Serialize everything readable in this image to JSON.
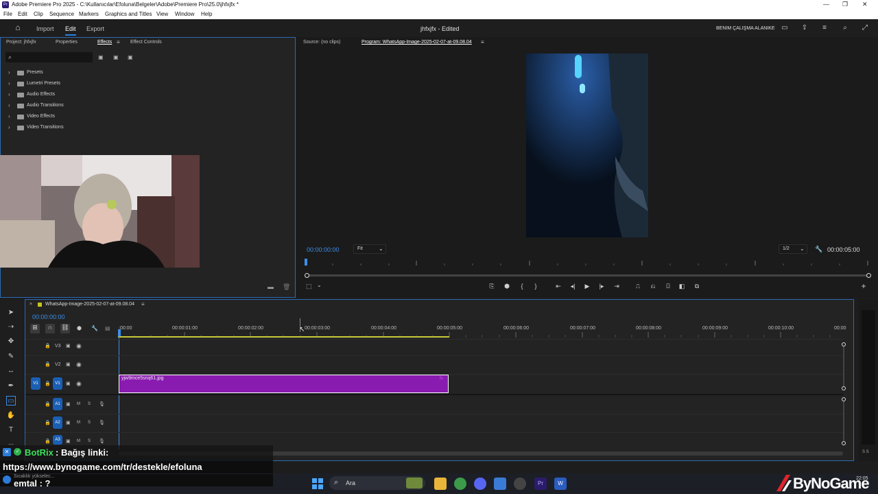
{
  "window": {
    "app_title": "Adobe Premiere Pro 2025 - C:\\Kullanıcılar\\Efoluna\\Belgeler\\Adobe\\Premiere Pro\\25.0\\jhfxjfx *",
    "logo_text": "Pr"
  },
  "menu": [
    "File",
    "Edit",
    "Clip",
    "Sequence",
    "Markers",
    "Graphics and Titles",
    "View",
    "Window",
    "Help"
  ],
  "header": {
    "nav": [
      "Import",
      "Edit",
      "Export"
    ],
    "active_nav": "Edit",
    "project_status": "jhfxjfx - Edited",
    "workspace_label": "BENIM ÇALIŞMA ALANIKE"
  },
  "left_panel": {
    "tabs": [
      "Project: jhfxjfx",
      "Properties",
      "Effects",
      "Effect Controls"
    ],
    "active_tab": "Effects",
    "search_placeholder": "",
    "tree": [
      "Presets",
      "Lumetri Presets",
      "Audio Effects",
      "Audio Transitions",
      "Video Effects",
      "Video Transitions"
    ]
  },
  "monitor": {
    "source_tab": "Source: (no clips)",
    "program_tab": "Program: WhatsApp-Image-2025-02-07-at-09.08.04",
    "timecode": "00:00:00:00",
    "fit": "Fit",
    "resolution": "1/2",
    "duration": "00:00:05:00"
  },
  "timeline": {
    "sequence_tab": "WhatsApp-Image-2025-02-07-at-09.08.04",
    "timecode": "00:00:00:00",
    "ruler": [
      ":00:00",
      "00:00:01:00",
      "00:00:02:00",
      "00:00:03:00",
      "00:00:04:00",
      "00:00:05:00",
      "00:00:06:00",
      "00:00:07:00",
      "00:00:08:00",
      "00:00:09:00",
      "00:00:10:00",
      "00:00"
    ],
    "video_tracks": [
      "V3",
      "V2",
      "V1"
    ],
    "source_patch": "V1",
    "audio_tracks": [
      "A1",
      "A2",
      "A3"
    ],
    "clip_name": "yjw9mce5snq61.jpg",
    "clip_color": "#8a1bb0",
    "track_letters": {
      "mute": "M",
      "solo": "S"
    }
  },
  "overlay": {
    "bot_name": "BotRix",
    "bot_message": ": Bağış linki:",
    "link": "https://www.bynogame.com/tr/destekle/efoluna",
    "user_line": "emtal : ?",
    "weather": "Sıcaklık yükselec..."
  },
  "taskbar": {
    "search_label": "Ara",
    "clock": "22:05"
  },
  "brand": {
    "text": "ByNoGame"
  },
  "meters": {
    "label": "S S"
  }
}
